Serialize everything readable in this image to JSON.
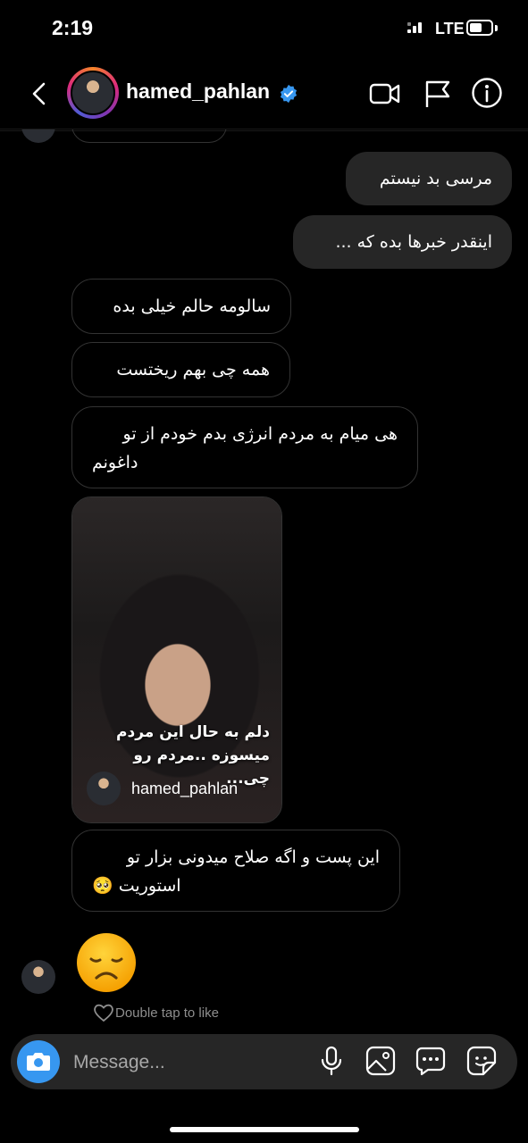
{
  "status_bar": {
    "time": "2:19",
    "network": "LTE"
  },
  "header": {
    "username": "hamed_pahlan"
  },
  "messages": [
    {
      "text": "مرسی بد نیستم"
    },
    {
      "text": "اینقدر خبرها بده که ..."
    },
    {
      "text": "سالومه حالم خیلی بده"
    },
    {
      "text": "همه چی بهم ریختست"
    },
    {
      "line1": "هی میام به مردم انرژی بدم خودم از تو",
      "line2": "داغونم"
    },
    {
      "line1": "این پست و اگه صلاح میدونی بزار تو",
      "line2": "استوریت 🥺"
    }
  ],
  "shared_post": {
    "caption_line1": "دلم به حال این مردم",
    "caption_line2": "میسوزه ..مردم رو چی...",
    "username": "hamed_pahlan"
  },
  "reaction_hint": "Double tap to like",
  "composer": {
    "placeholder": "Message..."
  },
  "colors": {
    "accent": "#3797f0",
    "outgoing_bubble": "#262626",
    "verified": "#3797f0"
  },
  "icons": [
    "back-arrow-icon",
    "verified-badge-icon",
    "video-call-icon",
    "flag-icon",
    "info-icon",
    "camera-icon",
    "microphone-icon",
    "gallery-icon",
    "chat-bubble-icon",
    "sticker-icon",
    "heart-icon"
  ]
}
